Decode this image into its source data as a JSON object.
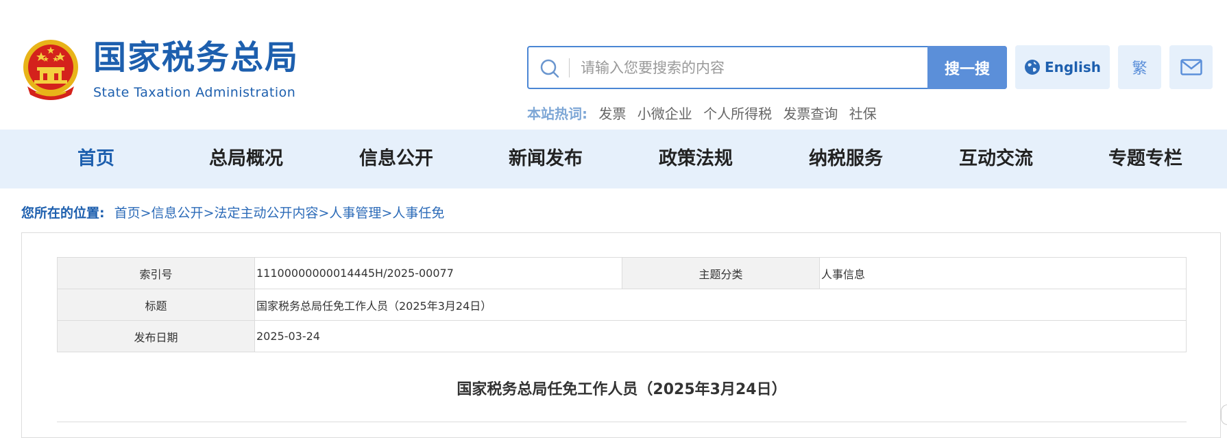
{
  "header": {
    "logo_cn": "国家税务总局",
    "logo_en": "State Taxation Administration",
    "search": {
      "placeholder": "请输入您要搜索的内容",
      "button": "搜一搜"
    },
    "hot": {
      "label": "本站热词:",
      "items": [
        "发票",
        "小微企业",
        "个人所得税",
        "发票查询",
        "社保"
      ]
    },
    "english_label": "English",
    "trad_label": "繁",
    "icons": {
      "search": "search-icon",
      "globe": "globe-icon",
      "mail": "mail-icon",
      "emblem": "national-emblem"
    }
  },
  "nav": {
    "items": [
      "首页",
      "总局概况",
      "信息公开",
      "新闻发布",
      "政策法规",
      "纳税服务",
      "互动交流",
      "专题专栏"
    ],
    "active": "首页"
  },
  "breadcrumb": {
    "label": "您所在的位置:",
    "items": [
      "首页",
      "信息公开",
      "法定主动公开内容",
      "人事管理",
      "人事任免"
    ],
    "separator": ">"
  },
  "meta": {
    "index_label": "索引号",
    "index_value": "11100000000014445H/2025-00077",
    "topic_label": "主题分类",
    "topic_value": "人事信息",
    "title_label": "标题",
    "title_value": "国家税务总局任免工作人员（2025年3月24日）",
    "date_label": "发布日期",
    "date_value": "2025-03-24"
  },
  "article": {
    "title": "国家税务总局任免工作人员（2025年3月24日）"
  },
  "colors": {
    "brand_blue": "#1d5fae",
    "search_button": "#5b8fd9",
    "nav_bg": "#e6f0fb"
  }
}
